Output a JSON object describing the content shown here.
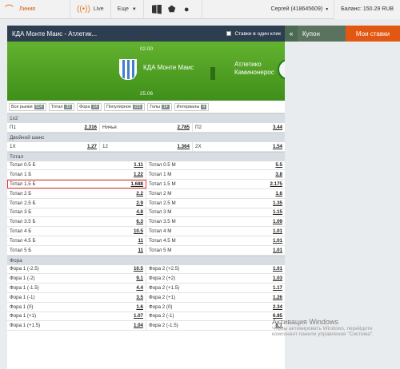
{
  "topbar": {
    "logo_label": "Линия",
    "live_label": "Live",
    "more_label": "Еще",
    "user": "Сергей (418645609)",
    "balance": "Баланс: 150.29 RUB"
  },
  "match": {
    "title": "КДА Монте Маис - Атлетик...",
    "single_click": "Ставки в один клик",
    "date_top": "02.00",
    "date_bottom": "25.06",
    "team_home": "КДА Монте Маис",
    "team_away_line1": "Атлетико",
    "team_away_line2": "Каминонерос"
  },
  "filters": [
    {
      "label": "Все рынки",
      "count": "514"
    },
    {
      "label": "Тотал",
      "count": "39"
    },
    {
      "label": "Фора",
      "count": "14"
    },
    {
      "label": "Популярное",
      "count": "221"
    },
    {
      "label": "Голы",
      "count": "14"
    },
    {
      "label": "Интервалы",
      "count": "4"
    }
  ],
  "sections": {
    "s1x2": {
      "title": "1x2",
      "rows": [
        [
          {
            "l": "П1",
            "o": "2.316"
          },
          {
            "l": "Ничья",
            "o": "2.785"
          },
          {
            "l": "П2",
            "o": "3.44"
          }
        ]
      ]
    },
    "double": {
      "title": "Двойной шанс",
      "rows": [
        [
          {
            "l": "1X",
            "o": "1.27"
          },
          {
            "l": "12",
            "o": "1.364"
          },
          {
            "l": "2X",
            "o": "1.54"
          }
        ]
      ]
    },
    "total": {
      "title": "Тотал",
      "rows": [
        [
          {
            "l": "Тотал 0.5 Б",
            "o": "1.11"
          },
          {
            "l": "Тотал 0.5 М",
            "o": "5.5"
          }
        ],
        [
          {
            "l": "Тотал 1 Б",
            "o": "1.22"
          },
          {
            "l": "Тотал 1 М",
            "o": "3.8"
          }
        ],
        [
          {
            "l": "Тотал 1.5 Б",
            "o": "1.688"
          },
          {
            "l": "Тотал 1.5 М",
            "o": "2.175"
          }
        ],
        [
          {
            "l": "Тотал 2 Б",
            "o": "2.2"
          },
          {
            "l": "Тотал 2 М",
            "o": "1.6"
          }
        ],
        [
          {
            "l": "Тотал 2.5 Б",
            "o": "2.9"
          },
          {
            "l": "Тотал 2.5 М",
            "o": "1.35"
          }
        ],
        [
          {
            "l": "Тотал 3 Б",
            "o": "4.8"
          },
          {
            "l": "Тотал 3 М",
            "o": "1.15"
          }
        ],
        [
          {
            "l": "Тотал 3.5 Б",
            "o": "6.3"
          },
          {
            "l": "Тотал 3.5 М",
            "o": "1.09"
          }
        ],
        [
          {
            "l": "Тотал 4 Б",
            "o": "10.5"
          },
          {
            "l": "Тотал 4 М",
            "o": "1.01"
          }
        ],
        [
          {
            "l": "Тотал 4.5 Б",
            "o": "11"
          },
          {
            "l": "Тотал 4.5 М",
            "o": "1.01"
          }
        ],
        [
          {
            "l": "Тотал 5 Б",
            "o": "11"
          },
          {
            "l": "Тотал 5 М",
            "o": "1.01"
          }
        ]
      ]
    },
    "fora": {
      "title": "Фора",
      "rows": [
        [
          {
            "l": "Фора 1 (-2.5)",
            "o": "10.5"
          },
          {
            "l": "Фора 2 (+2.5)",
            "o": "1.01"
          }
        ],
        [
          {
            "l": "Фора 1 (-2)",
            "o": "9.1"
          },
          {
            "l": "Фора 2 (+2)",
            "o": "1.03"
          }
        ],
        [
          {
            "l": "Фора 1 (-1.5)",
            "o": "4.4"
          },
          {
            "l": "Фора 2 (+1.5)",
            "o": "1.17"
          }
        ],
        [
          {
            "l": "Фора 1 (-1)",
            "o": "3.5"
          },
          {
            "l": "Фора 2 (+1)",
            "o": "1.26"
          }
        ],
        [
          {
            "l": "Фора 1 (0)",
            "o": "1.6"
          },
          {
            "l": "Фора 2 (0)",
            "o": "2.34"
          }
        ],
        [
          {
            "l": "Фора 1 (+1)",
            "o": "1.07"
          },
          {
            "l": "Фора 2 (-1)",
            "o": "6.85"
          }
        ],
        [
          {
            "l": "Фора 1 (+1.5)",
            "o": "1.04"
          },
          {
            "l": "Фора 2 (-1.5)",
            "o": "8.7"
          }
        ]
      ]
    }
  },
  "coupon": {
    "label": "Купон",
    "my_bets": "Мои ставки"
  },
  "watermark": {
    "title": "Активация Windows",
    "line1": "Чтобы активировать Windows, перейдите",
    "line2": "компонент панели управления \"Система\"."
  }
}
